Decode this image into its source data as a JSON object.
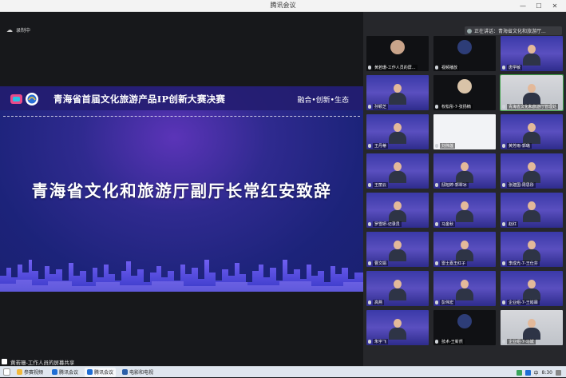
{
  "window": {
    "title": "腾讯会议",
    "minimize": "—",
    "maximize": "☐",
    "close": "✕"
  },
  "recording": {
    "label": "录制中"
  },
  "slide": {
    "title": "青海省首届文化旅游产品IP创新大赛决赛",
    "tagline": "融合•创新•生态",
    "main_text": "青海省文化和旅游厅副厅长常红安致辞"
  },
  "share": {
    "label": "黄若珊-工作人员的屏幕共享"
  },
  "speaking": {
    "label": "正在讲话：青海省文化和旅游厅..."
  },
  "participants": [
    {
      "name": "黄若珊-工作人员的屏...",
      "style": "dark",
      "avatar": "#c9a48a"
    },
    {
      "name": "视频播放",
      "style": "dark",
      "avatar": "#2d3d77"
    },
    {
      "name": "唐学敏",
      "style": "slide-bg",
      "person": true
    },
    {
      "name": "孙颖芝",
      "style": "slide-bg",
      "person": true
    },
    {
      "name": "权松彤-7-张扬楠",
      "style": "dark",
      "avatar": "#d9c3a8"
    },
    {
      "name": "青海省文化和旅游厅管理处",
      "style": "photo",
      "person": true
    },
    {
      "name": "王丹蒂",
      "style": "slide-bg",
      "person": true
    },
    {
      "name": "刘伟莲",
      "style": "white"
    },
    {
      "name": "黄芳雨-郭璐",
      "style": "slide-bg",
      "person": true
    },
    {
      "name": "王丽云",
      "style": "slide-bg",
      "person": true
    },
    {
      "name": "邸旭婷-郭翠冰",
      "style": "slide-bg",
      "person": true
    },
    {
      "name": "张建国-周思彤",
      "style": "slide-bg",
      "person": true
    },
    {
      "name": "罗雪妍-记录员",
      "style": "slide-bg",
      "person": true
    },
    {
      "name": "马金秋",
      "style": "slide-bg",
      "person": true
    },
    {
      "name": "赵红",
      "style": "slide-bg",
      "person": true
    },
    {
      "name": "曹文娟",
      "style": "slide-bg",
      "person": true
    },
    {
      "name": "雷士嘉王红子",
      "style": "slide-bg",
      "person": true
    },
    {
      "name": "李成光-7-王仕芬",
      "style": "slide-bg",
      "person": true
    },
    {
      "name": "高燕",
      "style": "slide-bg",
      "person": true
    },
    {
      "name": "彭伟宏",
      "style": "slide-bg",
      "person": true
    },
    {
      "name": "企业组-7-王崧霖",
      "style": "slide-bg",
      "person": true
    },
    {
      "name": "朱宇飞",
      "style": "slide-bg",
      "person": true
    },
    {
      "name": "技术-王新然",
      "style": "dark",
      "avatar": "#2d3d77"
    },
    {
      "name": "企业组-7-马斌",
      "style": "photo",
      "person": true
    }
  ],
  "taskbar": {
    "apps": [
      {
        "label": "参赛视频",
        "color": "#f2b93c"
      },
      {
        "label": "腾讯会议",
        "color": "#1f6ed4",
        "active": false
      },
      {
        "label": "腾讯会议",
        "color": "#1f6ed4",
        "active": true
      },
      {
        "label": "电影和电视",
        "color": "#2b5fa8"
      }
    ],
    "time": "8:30",
    "lang": "中"
  }
}
